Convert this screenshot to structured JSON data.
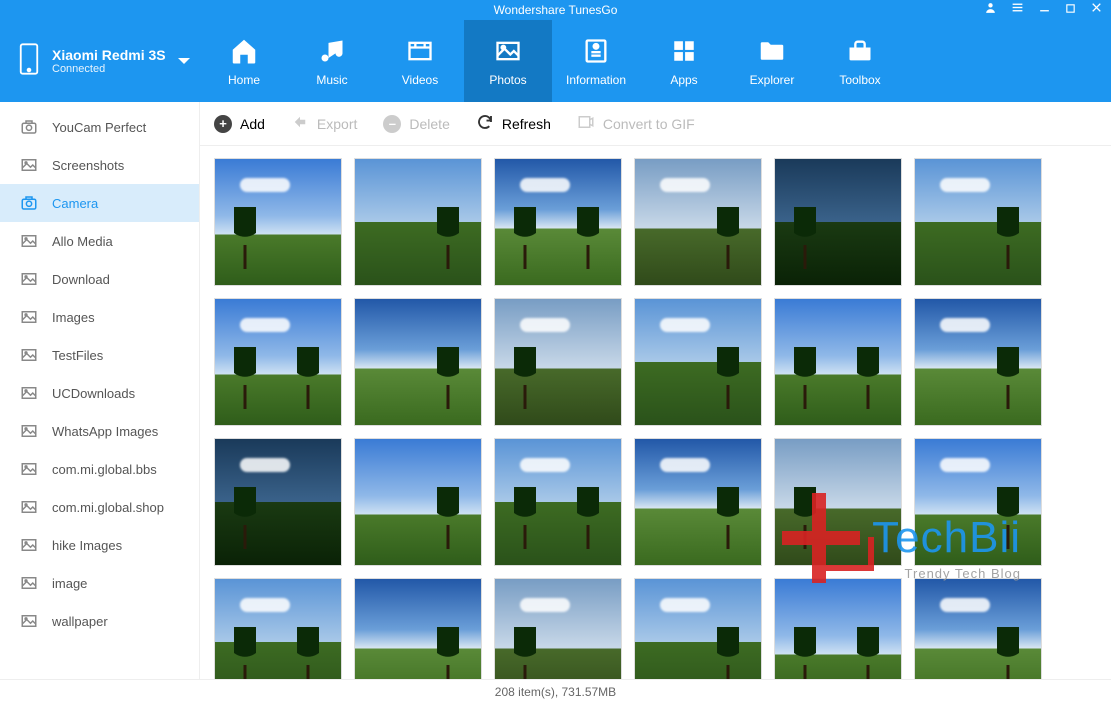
{
  "app": {
    "title": "Wondershare TunesGo"
  },
  "device": {
    "name": "Xiaomi Redmi 3S",
    "status": "Connected"
  },
  "tabs": [
    {
      "label": "Home"
    },
    {
      "label": "Music"
    },
    {
      "label": "Videos"
    },
    {
      "label": "Photos"
    },
    {
      "label": "Information"
    },
    {
      "label": "Apps"
    },
    {
      "label": "Explorer"
    },
    {
      "label": "Toolbox"
    }
  ],
  "sidebar": [
    {
      "label": "YouCam Perfect",
      "icon": "camera"
    },
    {
      "label": "Screenshots",
      "icon": "image"
    },
    {
      "label": "Camera",
      "icon": "camera",
      "selected": true
    },
    {
      "label": "Allo Media",
      "icon": "image"
    },
    {
      "label": "Download",
      "icon": "image"
    },
    {
      "label": "Images",
      "icon": "image"
    },
    {
      "label": "TestFiles",
      "icon": "image"
    },
    {
      "label": "UCDownloads",
      "icon": "image"
    },
    {
      "label": "WhatsApp Images",
      "icon": "image"
    },
    {
      "label": "com.mi.global.bbs",
      "icon": "image"
    },
    {
      "label": "com.mi.global.shop",
      "icon": "image"
    },
    {
      "label": "hike Images",
      "icon": "image"
    },
    {
      "label": "image",
      "icon": "image"
    },
    {
      "label": "wallpaper",
      "icon": "image"
    }
  ],
  "toolbar": {
    "add": "Add",
    "export": "Export",
    "delete": "Delete",
    "refresh": "Refresh",
    "convert": "Convert to GIF"
  },
  "status": {
    "text": "208 item(s), 731.57MB"
  },
  "watermark": {
    "text": "TechBii",
    "sub": "Trendy Tech Blog"
  }
}
